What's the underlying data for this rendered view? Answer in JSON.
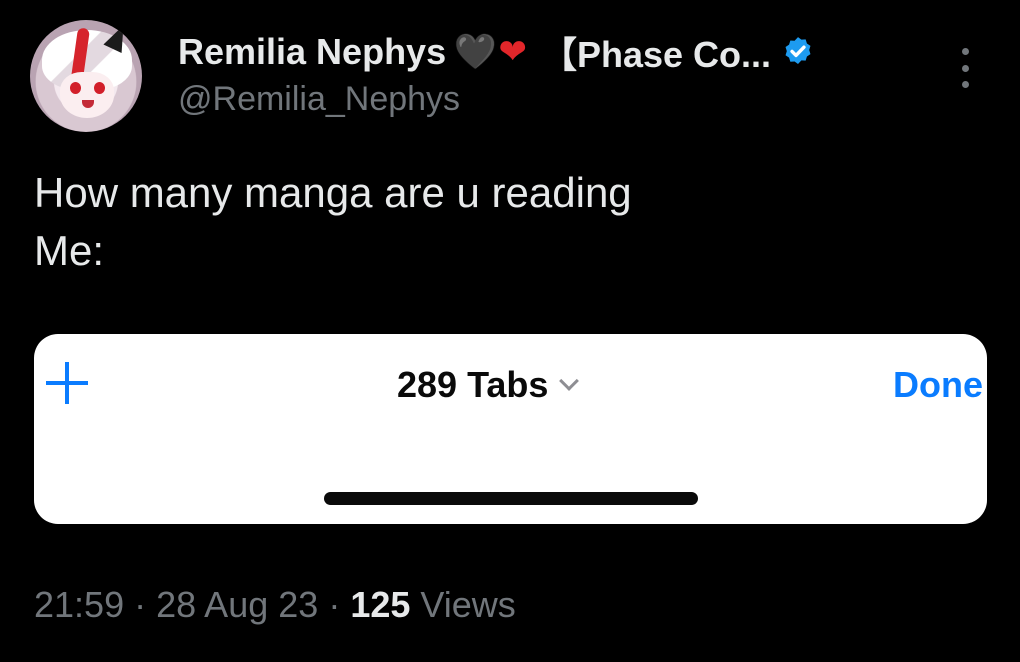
{
  "author": {
    "display_name": "Remilia Nephys",
    "heart_black": "🖤",
    "heart_red": "❤",
    "name_suffix": "【Phase Co...",
    "handle": "@Remilia_Nephys",
    "verified_color": "#1d9bf0"
  },
  "tweet": {
    "line1": "How many manga are u reading",
    "line2": "Me:"
  },
  "embedded_card": {
    "title": "289 Tabs",
    "done_label": "Done",
    "plus_icon": "plus-icon",
    "accent_color": "#0a7cff"
  },
  "meta": {
    "time": "21:59",
    "sep1": "·",
    "date": "28 Aug 23",
    "sep2": "·",
    "views_count": "125",
    "views_label": "Views"
  }
}
